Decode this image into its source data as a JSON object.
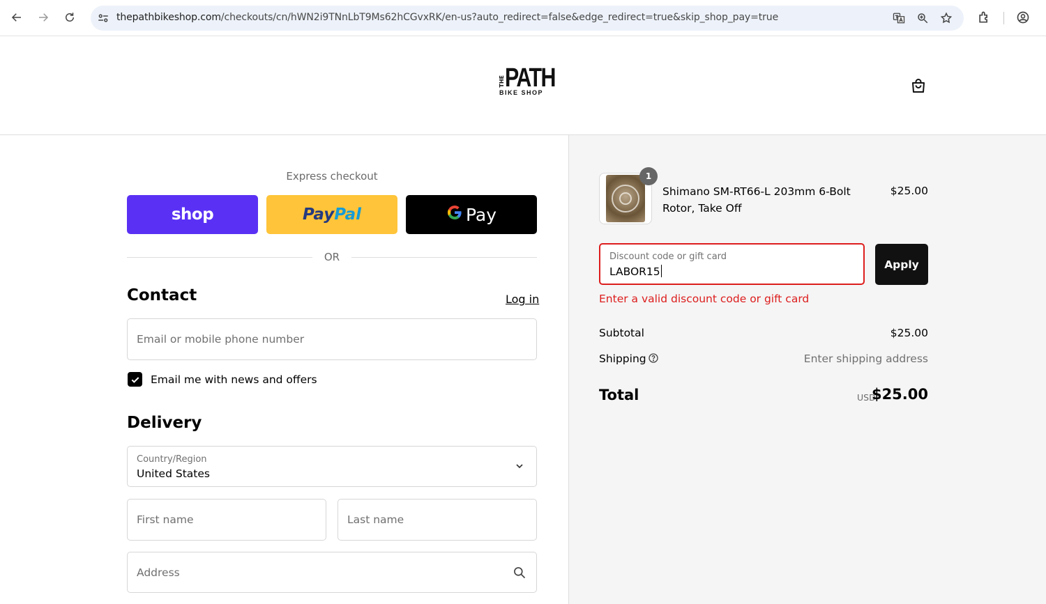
{
  "browser": {
    "url_host": "thepathbikeshop.com",
    "url_path": "/checkouts/cn/hWN2i9TNnLbT9Ms62hCGvxRK/en-us?auto_redirect=false&edge_redirect=true&skip_shop_pay=true",
    "icons": [
      "back-icon",
      "forward-icon",
      "reload-icon",
      "site-info-icon",
      "translate-icon",
      "zoom-icon",
      "bookmark-star-icon",
      "extensions-icon",
      "profile-icon"
    ]
  },
  "header": {
    "logo_main": "PATH",
    "logo_the": "THE",
    "logo_sub": "BIKE SHOP",
    "cart_icon": "shopping-bag-icon"
  },
  "express": {
    "label": "Express checkout",
    "shop_label": "shop",
    "paypal_part1": "Pay",
    "paypal_part2": "Pal",
    "gpay_g": "G",
    "gpay_label": "Pay",
    "or_label": "OR",
    "colors": {
      "shop": "#5a31f4",
      "paypal": "#ffc439",
      "gpay": "#000000"
    }
  },
  "contact": {
    "title": "Contact",
    "login_label": "Log in",
    "email_placeholder": "Email or mobile phone number",
    "newsletter_label": "Email me with news and offers",
    "newsletter_checked": true
  },
  "delivery": {
    "title": "Delivery",
    "country_label": "Country/Region",
    "country_value": "United States",
    "first_name_placeholder": "First name",
    "last_name_placeholder": "Last name",
    "address_placeholder": "Address"
  },
  "summary": {
    "product": {
      "name": "Shimano SM-RT66-L 203mm 6-Bolt Rotor, Take Off",
      "price": "$25.00",
      "quantity": "1"
    },
    "discount": {
      "label": "Discount code or gift card",
      "value": "LABOR15",
      "apply_label": "Apply",
      "error": "Enter a valid discount code or gift card",
      "error_color": "#dd1d1d"
    },
    "subtotal_label": "Subtotal",
    "subtotal_value": "$25.00",
    "shipping_label": "Shipping",
    "shipping_value": "Enter shipping address",
    "total_label": "Total",
    "total_currency": "USD",
    "total_value": "$25.00"
  }
}
